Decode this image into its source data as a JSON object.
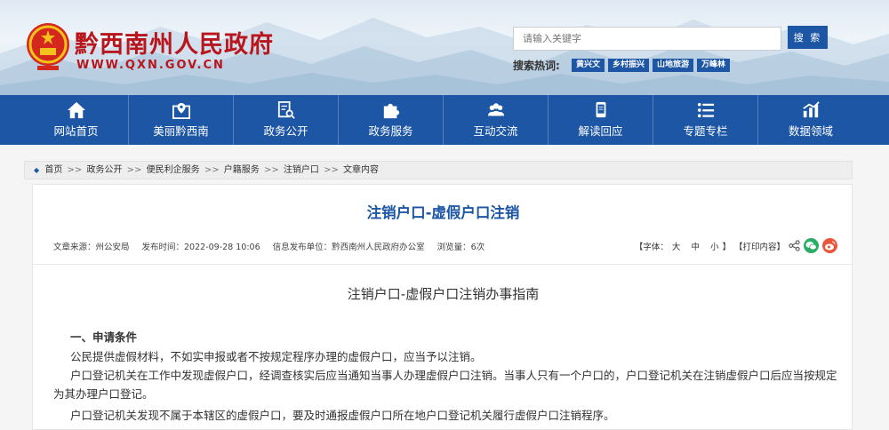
{
  "site": {
    "name": "黔西南州人民政府",
    "url": "WWW.QXN.GOV.CN"
  },
  "search": {
    "placeholder": "请输入关键字",
    "button_label": "搜 索",
    "hot_label": "搜索热词:",
    "hot_tags": [
      "黄兴文",
      "乡村振兴",
      "山地旅游",
      "万峰林"
    ]
  },
  "nav": {
    "items": [
      {
        "label": "网站首页",
        "icon": "home-icon"
      },
      {
        "label": "美丽黔西南",
        "icon": "map-pin-icon"
      },
      {
        "label": "政务公开",
        "icon": "document-search-icon"
      },
      {
        "label": "政务服务",
        "icon": "puzzle-icon"
      },
      {
        "label": "互动交流",
        "icon": "people-icon"
      },
      {
        "label": "解读回应",
        "icon": "tablet-icon"
      },
      {
        "label": "专题专栏",
        "icon": "list-icon"
      },
      {
        "label": "数据领域",
        "icon": "chart-icon"
      }
    ]
  },
  "breadcrumb": {
    "items": [
      "首页",
      "政务公开",
      "便民利企服务",
      "户籍服务",
      "注销户口",
      "文章内容"
    ],
    "separator": ">>"
  },
  "article": {
    "title": "注销户口-虚假户口注销",
    "meta": {
      "source": "文章来源：州公安局",
      "publish_time": "发布时间：2022-09-28 10:06",
      "publisher": "信息发布单位：黔西南州人民政府办公室",
      "views": "浏览量：6次"
    },
    "tools": {
      "font_label": "【字体：",
      "font_large": "大",
      "font_medium": "中",
      "font_small": "小",
      "font_close": "】",
      "print": "【打印内容】"
    },
    "doc_title": "注销户口-虚假户口注销办事指南",
    "section_heading": "一、申请条件",
    "paragraphs": [
      "公民提供虚假材料，不如实申报或者不按规定程序办理的虚假户口，应当予以注销。",
      "户口登记机关在工作中发现虚假户口，经调查核实后应当通知当事人办理虚假户口注销。当事人只有一个户口的，户口登记机关在注销虚假户口后应当按规定",
      "为其办理户口登记。",
      "户口登记机关发现不属于本辖区的虚假户口，要及时通报虚假户口所在地户口登记机关履行虚假户口注销程序。"
    ]
  },
  "colors": {
    "brand_blue": "#1c56a4",
    "title_red": "#b8161c",
    "wechat_green": "#2aae67",
    "weibo_orange": "#e8573c"
  }
}
